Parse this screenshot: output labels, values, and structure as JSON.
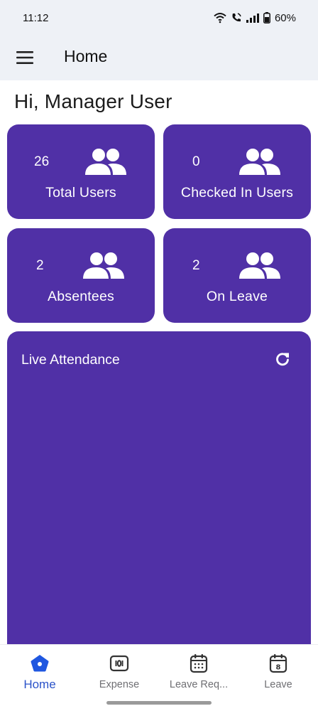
{
  "status_bar": {
    "time": "11:12",
    "battery": "60%",
    "icons": [
      "wifi-icon",
      "call-icon",
      "signal-icon",
      "battery-icon"
    ]
  },
  "app_bar": {
    "title": "Home",
    "menu_icon": "hamburger-menu-icon"
  },
  "greeting": "Hi, Manager User",
  "stats": [
    {
      "count": "26",
      "label": "Total Users",
      "icon": "users-icon"
    },
    {
      "count": "0",
      "label": "Checked In Users",
      "icon": "users-icon"
    },
    {
      "count": "2",
      "label": "Absentees",
      "icon": "users-icon"
    },
    {
      "count": "2",
      "label": "On Leave",
      "icon": "users-icon"
    }
  ],
  "live_attendance": {
    "title": "Live Attendance",
    "refresh_icon": "refresh-icon"
  },
  "bottom_nav": [
    {
      "label": "Home",
      "icon": "home-icon",
      "active": true
    },
    {
      "label": "Expense",
      "icon": "expense-icon",
      "active": false
    },
    {
      "label": "Leave Req...",
      "icon": "calendar-icon",
      "active": false
    },
    {
      "label": "Leave",
      "icon": "calendar-day-icon",
      "active": false
    }
  ],
  "colors": {
    "primary": "#5030a6",
    "bar_background": "#eef1f6",
    "nav_active": "#2b53c9",
    "nav_inactive": "#6f6f73"
  }
}
